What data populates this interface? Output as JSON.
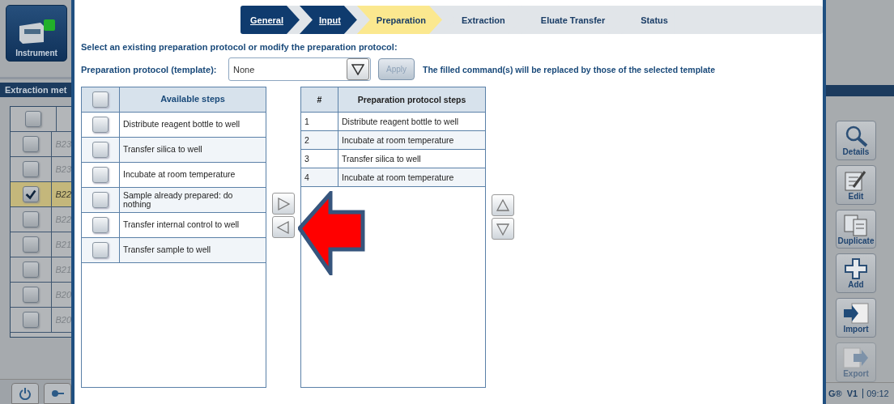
{
  "left_panel": {
    "instrument_button": {
      "label": "Instrument"
    },
    "panel_title": "Extraction met",
    "header_checked": false,
    "rows": [
      {
        "text": "B23",
        "checked": false,
        "selected": false
      },
      {
        "text": "B23",
        "checked": false,
        "selected": false
      },
      {
        "text": "B22",
        "checked": true,
        "selected": true
      },
      {
        "text": "B22",
        "checked": false,
        "selected": false
      },
      {
        "text": "B21",
        "checked": false,
        "selected": false
      },
      {
        "text": "B21",
        "checked": false,
        "selected": false
      },
      {
        "text": "B20",
        "checked": false,
        "selected": false
      },
      {
        "text": "B20",
        "checked": false,
        "selected": false
      }
    ]
  },
  "wizard": {
    "steps": [
      {
        "label": "General",
        "completed": true,
        "selected": false
      },
      {
        "label": "Input",
        "completed": true,
        "selected": false
      },
      {
        "label": "Preparation",
        "completed": false,
        "selected": true
      },
      {
        "label": "Extraction",
        "completed": false,
        "selected": false
      },
      {
        "label": "Eluate Transfer",
        "completed": false,
        "selected": false
      },
      {
        "label": "Status",
        "completed": false,
        "selected": false
      }
    ],
    "intro": "Select an existing preparation protocol or modify the preparation protocol:",
    "template_label": "Preparation protocol (template):",
    "template_value": "None",
    "apply_button": {
      "label": "Apply",
      "disabled": true
    },
    "template_note": "The filled command(s) will be replaced by those of the selected template",
    "available": {
      "header": "Available steps",
      "header_checked": false,
      "items": [
        {
          "text": "Distribute reagent bottle to well",
          "checked": false
        },
        {
          "text": "Transfer silica to well",
          "checked": false
        },
        {
          "text": "Incubate at room temperature",
          "checked": false
        },
        {
          "text": "Sample already prepared: do nothing",
          "checked": false
        },
        {
          "text": "Transfer internal control to well",
          "checked": false
        },
        {
          "text": "Transfer sample to well",
          "checked": false
        }
      ]
    },
    "protocol": {
      "columns": [
        "#",
        "Preparation protocol steps"
      ],
      "rows": [
        {
          "number": "1",
          "text": "Distribute reagent bottle to well"
        },
        {
          "number": "2",
          "text": "Incubate at room temperature"
        },
        {
          "number": "3",
          "text": "Transfer silica to well"
        },
        {
          "number": "4",
          "text": "Incubate at room temperature"
        }
      ]
    }
  },
  "right_panel": {
    "buttons": [
      {
        "label": "Details",
        "kind": "details",
        "disabled": false
      },
      {
        "label": "Edit",
        "kind": "edit",
        "disabled": false
      },
      {
        "label": "Duplicate",
        "kind": "duplicate",
        "disabled": false
      },
      {
        "label": "Add",
        "kind": "add",
        "disabled": false
      },
      {
        "label": "Import",
        "kind": "import",
        "disabled": false
      },
      {
        "label": "Export",
        "kind": "export",
        "disabled": true
      }
    ],
    "footer": {
      "brand": "G®",
      "version": "V1",
      "time": "09:12"
    }
  }
}
